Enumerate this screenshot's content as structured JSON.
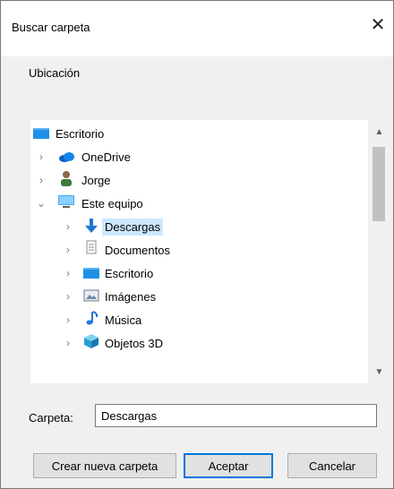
{
  "dialog": {
    "title": "Buscar carpeta",
    "close_symbol": "✕",
    "description": "Ubicación"
  },
  "tree": {
    "items": [
      {
        "label": "Escritorio",
        "icon": "desktop-icon",
        "expander": "",
        "selected": false
      },
      {
        "label": "OneDrive",
        "icon": "onedrive-icon",
        "expander": "›",
        "selected": false
      },
      {
        "label": "Jorge",
        "icon": "user-icon",
        "expander": "›",
        "selected": false
      },
      {
        "label": "Este equipo",
        "icon": "computer-icon",
        "expander": "⌄",
        "selected": false
      },
      {
        "label": "Descargas",
        "icon": "downloads-icon",
        "expander": "›",
        "selected": true
      },
      {
        "label": "Documentos",
        "icon": "documents-icon",
        "expander": "›",
        "selected": false
      },
      {
        "label": "Escritorio",
        "icon": "desktop-icon",
        "expander": "›",
        "selected": false
      },
      {
        "label": "Imágenes",
        "icon": "pictures-icon",
        "expander": "›",
        "selected": false
      },
      {
        "label": "Música",
        "icon": "music-icon",
        "expander": "›",
        "selected": false
      },
      {
        "label": "Objetos 3D",
        "icon": "objects-3d-icon",
        "expander": "›",
        "selected": false
      }
    ],
    "scroll_up": "▲",
    "scroll_down": "▼"
  },
  "folder": {
    "label": "Carpeta:",
    "value": "Descargas"
  },
  "buttons": {
    "new_folder": "Crear nueva carpeta",
    "ok": "Aceptar",
    "cancel": "Cancelar"
  },
  "colors": {
    "selection": "#cce8ff",
    "accent": "#0078d7",
    "dialog_bg": "#f0f0f0"
  }
}
